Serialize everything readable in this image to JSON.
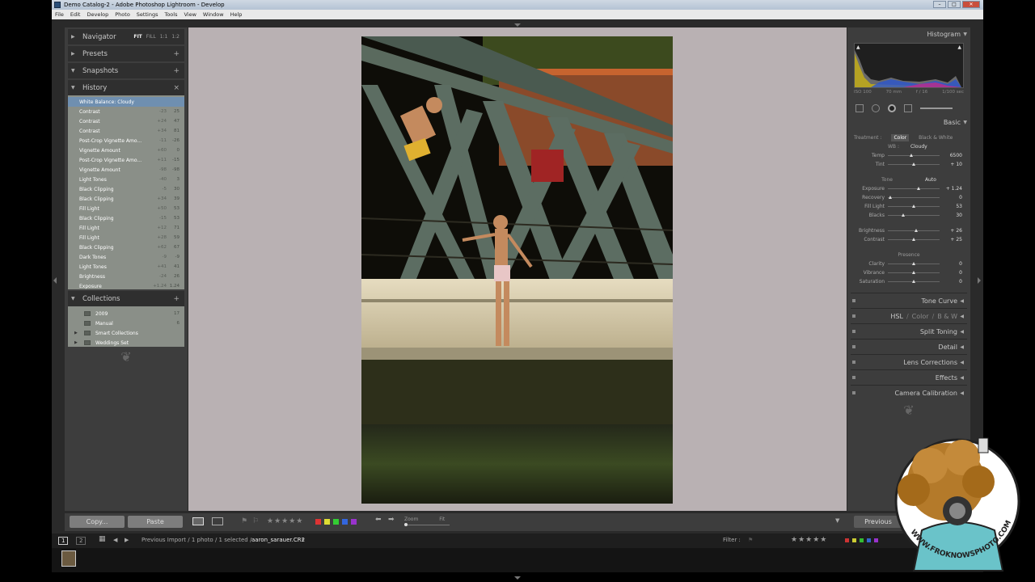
{
  "window": {
    "title": "Demo Catalog-2 - Adobe Photoshop Lightroom - Develop",
    "minimize": "–",
    "maximize": "□",
    "close": "✕"
  },
  "menu": [
    "File",
    "Edit",
    "Develop",
    "Photo",
    "Settings",
    "Tools",
    "View",
    "Window",
    "Help"
  ],
  "left_panel": {
    "navigator": {
      "label": "Navigator",
      "opts": [
        "FIT",
        "FILL",
        "1:1",
        "1:2"
      ]
    },
    "presets": {
      "label": "Presets"
    },
    "snapshots": {
      "label": "Snapshots"
    },
    "history": {
      "label": "History",
      "items": [
        {
          "name": "White Balance: Cloudy",
          "a": "",
          "b": ""
        },
        {
          "name": "Contrast",
          "a": "-23",
          "b": "25"
        },
        {
          "name": "Contrast",
          "a": "+24",
          "b": "47"
        },
        {
          "name": "Contrast",
          "a": "+34",
          "b": "81"
        },
        {
          "name": "Post-Crop Vignette Amo...",
          "a": "-11",
          "b": "-26"
        },
        {
          "name": "Vignette Amount",
          "a": "+60",
          "b": "0"
        },
        {
          "name": "Post-Crop Vignette Amo...",
          "a": "+11",
          "b": "-15"
        },
        {
          "name": "Vignette Amount",
          "a": "-98",
          "b": "-98"
        },
        {
          "name": "Light Tones",
          "a": "-40",
          "b": "3"
        },
        {
          "name": "Black Clipping",
          "a": "-5",
          "b": "30"
        },
        {
          "name": "Black Clipping",
          "a": "+34",
          "b": "39"
        },
        {
          "name": "Fill Light",
          "a": "+50",
          "b": "53"
        },
        {
          "name": "Black Clipping",
          "a": "-15",
          "b": "53"
        },
        {
          "name": "Fill Light",
          "a": "+12",
          "b": "71"
        },
        {
          "name": "Fill Light",
          "a": "+28",
          "b": "59"
        },
        {
          "name": "Black Clipping",
          "a": "+62",
          "b": "67"
        },
        {
          "name": "Dark Tones",
          "a": "-9",
          "b": "-9"
        },
        {
          "name": "Light Tones",
          "a": "+41",
          "b": "41"
        },
        {
          "name": "Brightness",
          "a": "-24",
          "b": "26"
        },
        {
          "name": "Exposure",
          "a": "+1.24",
          "b": "1.24"
        }
      ]
    },
    "collections": {
      "label": "Collections",
      "items": [
        {
          "name": "2009",
          "count": "17"
        },
        {
          "name": "Manual",
          "count": "6"
        },
        {
          "name": "Smart Collections",
          "count": ""
        },
        {
          "name": "Weddings Set",
          "count": ""
        }
      ]
    },
    "copy": "Copy...",
    "paste": "Paste"
  },
  "right_panel": {
    "histogram": {
      "label": "Histogram",
      "iso": "ISO 100",
      "focal": "70 mm",
      "aperture": "f / 16",
      "shutter": "1/100 sec"
    },
    "basic": {
      "label": "Basic",
      "treatment_label": "Treatment :",
      "color": "Color",
      "bw": "Black & White",
      "wb_label": "WB :",
      "wb_value": "Cloudy",
      "temp": {
        "label": "Temp",
        "value": "6500",
        "pos": 0.45
      },
      "tint": {
        "label": "Tint",
        "value": "+ 10",
        "pos": 0.5
      },
      "tone": "Tone",
      "auto": "Auto",
      "exposure": {
        "label": "Exposure",
        "value": "+ 1.24",
        "pos": 0.6
      },
      "recovery": {
        "label": "Recovery",
        "value": "0",
        "pos": 0.05
      },
      "fill": {
        "label": "Fill Light",
        "value": "53",
        "pos": 0.5
      },
      "blacks": {
        "label": "Blacks",
        "value": "30",
        "pos": 0.3
      },
      "brightness": {
        "label": "Brightness",
        "value": "+ 26",
        "pos": 0.55
      },
      "contrast": {
        "label": "Contrast",
        "value": "+ 25",
        "pos": 0.5
      },
      "presence": "Presence",
      "clarity": {
        "label": "Clarity",
        "value": "0",
        "pos": 0.5
      },
      "vibrance": {
        "label": "Vibrance",
        "value": "0",
        "pos": 0.5
      },
      "saturation": {
        "label": "Saturation",
        "value": "0",
        "pos": 0.5
      }
    },
    "sections": {
      "tone_curve": "Tone Curve",
      "hsl": "HSL",
      "color": "Color",
      "bw": "B & W",
      "split_toning": "Split Toning",
      "detail": "Detail",
      "lens": "Lens Corrections",
      "effects": "Effects",
      "calibration": "Camera Calibration"
    },
    "previous": "Previous"
  },
  "toolbar": {
    "zoom_label": "Zoom",
    "zoom_value": "Fit",
    "rating": "★★★★★"
  },
  "filmstrip": {
    "page1": "1",
    "page2": "2",
    "path": "Previous Import / 1 photo / 1 selected /",
    "filename": "aaron_sarauer.CR2",
    "filter_label": "Filter :",
    "rating": "★★★★★"
  },
  "watermark": {
    "text": "WWW.FROKNOWSPHOTO.COM"
  },
  "colors": {
    "accent_history": "#6f8fb0",
    "panel_bg": "#3d3d3d",
    "canvas_bg": "#b9b1b3",
    "label_colors": [
      "#d33",
      "#dd3",
      "#3c3",
      "#36d",
      "#93c"
    ]
  }
}
